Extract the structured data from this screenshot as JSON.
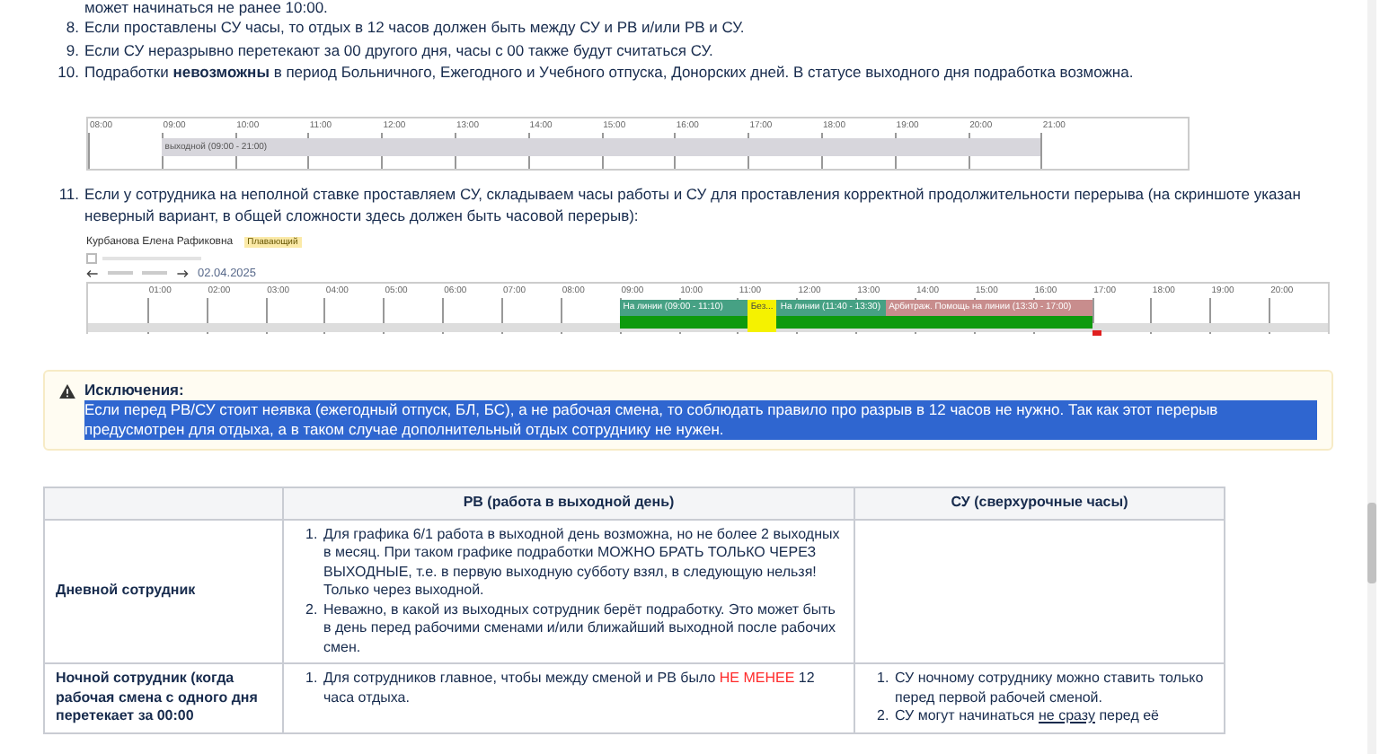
{
  "top_line": "может начинаться не ранее 10:00.",
  "rules": [
    {
      "number": "8.",
      "text": "Если проставлены СУ часы, то отдых в 12 часов должен быть между СУ и РВ и/или РВ и СУ."
    },
    {
      "number": "9.",
      "text": "Если СУ неразрывно перетекают за 00 другого дня, часы с 00 также будут считаться СУ."
    },
    {
      "number": "10.",
      "text": "Подработки **невозможны** в период Больничного, Ежегодного и Учебного отпуска, Донорских дней. В статусе выходного дня подработка возможна."
    }
  ],
  "timeline_1": {
    "hours": [
      "08:00",
      "09:00",
      "10:00",
      "11:00",
      "12:00",
      "13:00",
      "14:00",
      "15:00",
      "16:00",
      "17:00",
      "18:00",
      "19:00",
      "20:00",
      "21:00"
    ],
    "blocks": [
      {
        "label": "выходной (09:00 - 21:00)",
        "kind": "day_off"
      }
    ]
  },
  "rule_11": {
    "number": "11.",
    "text": "Если у сотрудника на неполной ставке проставляем СУ, складываем часы работы и СУ для проставления корректной продолжительности перерыва (на скриншоте указан неверный вариант, в общей сложности здесь должен быть часовой перерыв):"
  },
  "schedule": {
    "employee": "Курбанова Елена Рафиковна",
    "badge": "Плавающий",
    "date": "02.04.2025",
    "hours": [
      "01:00",
      "02:00",
      "03:00",
      "04:00",
      "05:00",
      "06:00",
      "07:00",
      "08:00",
      "09:00",
      "10:00",
      "11:00",
      "12:00",
      "13:00",
      "14:00",
      "15:00",
      "16:00",
      "17:00",
      "18:00",
      "19:00",
      "20:00"
    ],
    "checkbox": {
      "checked": false
    },
    "blocks": [
      {
        "label": "На линии (09:00 - 11:10)",
        "kind": "line"
      },
      {
        "label": "Без...",
        "kind": "break"
      },
      {
        "label": "На линии (11:40 - 13:30)",
        "kind": "line"
      },
      {
        "label": "Арбитраж. Помощь на линии (13:30 - 17:00)",
        "kind": "arbitration"
      }
    ]
  },
  "note": {
    "title": "Исключения:",
    "text": "Если перед РВ/СУ стоит неявка (ежегодный отпуск, БЛ, БС), а не рабочая смена, то соблюдать правило про разрыв в 12 часов не нужно. Так как этот перерыв предусмотрен для отдыха, а в таком случае дополнительный отдых сотруднику не нужен.",
    "selected": true
  },
  "table": {
    "columns": [
      "РВ (работа в выходной день)",
      "СУ (сверхурочные часы)"
    ],
    "rows": [
      {
        "header": "Дневной сотрудник",
        "rv": [
          [
            {
              "text": "1.",
              "kind": "marker"
            },
            {
              "text": "Для графика 6/1 работа в выходной день возможна, но не более 2 выходных в месяц. При таком графике подработки МОЖНО БРАТЬ ТОЛЬКО ЧЕРЕЗ ВЫХОДНЫЕ, т.е. в первую выходную субботу взял, в следующую нельзя! Только через выходной.",
              "kind": "plain"
            }
          ],
          [
            {
              "text": "2.",
              "kind": "marker"
            },
            {
              "text": "Неважно, в какой из выходных сотрудник берёт подработку. Это может быть в день перед рабочими сменами  и/или ближайший выходной после рабочих смен.",
              "kind": "plain"
            }
          ]
        ],
        "su": []
      },
      {
        "header": "Ночной сотрудник (когда рабочая смена с одного дня перетекает за 00:00",
        "rv": [
          [
            {
              "text": "1.",
              "kind": "marker"
            },
            {
              "text": "Для сотрудников главное, чтобы между сменой и РВ было ",
              "kind": "plain"
            },
            {
              "text": "НЕ МЕНЕЕ",
              "kind": "warning"
            },
            {
              "text": " 12 часа отдыха.",
              "kind": "plain"
            }
          ]
        ],
        "su": [
          [
            {
              "text": "1.",
              "kind": "marker"
            },
            {
              "text": "СУ ночному сотруднику можно ставить только перед первой рабочей сменой.",
              "kind": "plain"
            }
          ],
          [
            {
              "text": "2.",
              "kind": "marker"
            },
            {
              "text": "СУ могут начинаться ",
              "kind": "plain"
            },
            {
              "text": "не сразу",
              "kind": "underline"
            },
            {
              "text": " перед её",
              "kind": "plain"
            }
          ]
        ]
      }
    ]
  }
}
